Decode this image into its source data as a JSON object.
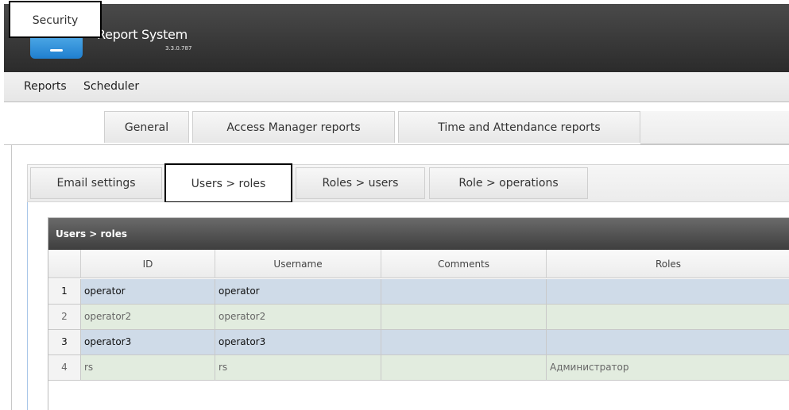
{
  "app": {
    "title": "Report System",
    "version": "3.3.0.787"
  },
  "menu": [
    "Reports",
    "Scheduler"
  ],
  "main_tabs": [
    "Security",
    "General",
    "Access Manager reports",
    "Time and Attendance reports"
  ],
  "sub_tabs": [
    "Email settings",
    "Users > roles",
    "Roles > users",
    "Role > operations"
  ],
  "grid": {
    "caption": "Users > roles",
    "columns": [
      "ID",
      "Username",
      "Comments",
      "Roles"
    ],
    "rows": [
      {
        "num": "1",
        "id": "operator",
        "username": "operator",
        "comments": "",
        "roles": ""
      },
      {
        "num": "2",
        "id": "operator2",
        "username": "operator2",
        "comments": "",
        "roles": ""
      },
      {
        "num": "3",
        "id": "operator3",
        "username": "operator3",
        "comments": "",
        "roles": ""
      },
      {
        "num": "4",
        "id": "rs",
        "username": "rs",
        "comments": "",
        "roles": "Администратор"
      }
    ]
  },
  "colors": {
    "header_dark": "#2b2b2b",
    "row_blue": "#cfdbe8",
    "row_green": "#e2ecdf",
    "accent_blue": "#2f8fd8"
  },
  "icons": [
    "folder-icon"
  ]
}
